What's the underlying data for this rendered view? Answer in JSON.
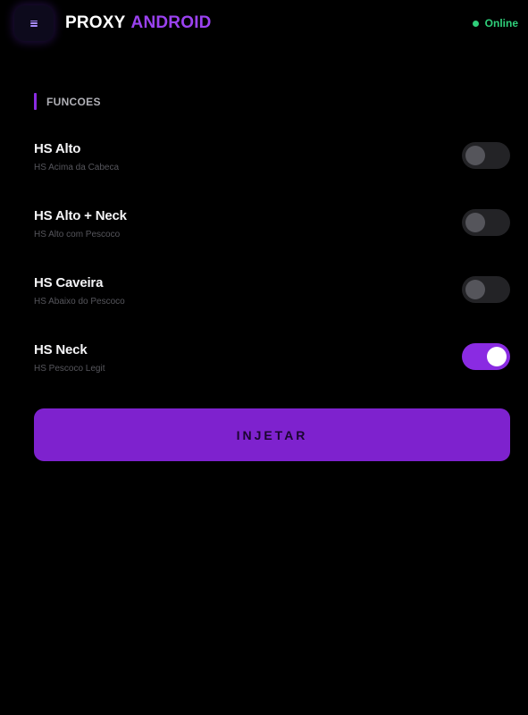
{
  "header": {
    "title_part1": "PROXY",
    "title_part2": "ANDROID",
    "menu_icon": "hamburger-icon",
    "status_text": "Online"
  },
  "section": {
    "title": "FUNCOES"
  },
  "toggles": [
    {
      "title": "HS Alto",
      "subtitle": "HS Acima da Cabeca",
      "enabled": false
    },
    {
      "title": "HS Alto + Neck",
      "subtitle": "HS Alto com Pescoco",
      "enabled": false
    },
    {
      "title": "HS Caveira",
      "subtitle": "HS Abaixo do Pescoco",
      "enabled": false
    },
    {
      "title": "HS Neck",
      "subtitle": "HS Pescoco Legit",
      "enabled": true
    }
  ],
  "inject_button": {
    "label": "INJETAR"
  },
  "colors": {
    "accent": "#8a2be2",
    "title_accent": "#9b42f0",
    "status": "#2fcf7a",
    "background": "#000000"
  }
}
